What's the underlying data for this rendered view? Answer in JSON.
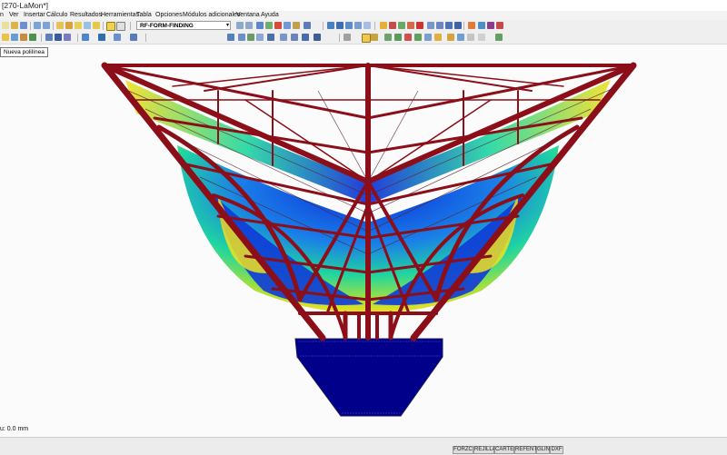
{
  "window": {
    "title": "[270-LaMon*]"
  },
  "menu": [
    "n",
    "Ver",
    "Insertar",
    "Cálculo",
    "Resultados",
    "Herramientas",
    "Tabla",
    "Opciones",
    "Módulos adicionales",
    "Ventana",
    "Ayuda"
  ],
  "toolbar": {
    "module_select": "RF-FORM-FINDING",
    "module_select_arrow": "▾"
  },
  "tooltip": {
    "text": "Nueva polilínea"
  },
  "status": {
    "coordinate": "u: 0.0 mm"
  },
  "status_buttons": [
    "FORZC",
    "REJILLA",
    "CARTES",
    "REFENT",
    "GLIN",
    "DXF"
  ],
  "colors": {
    "frame": "#8b0e18",
    "support_box": "#00008b",
    "membrane_low": "#0a28d8",
    "membrane_mid": "#1fd6a0",
    "membrane_high": "#f0e020"
  },
  "icons": [
    "new-file-icon",
    "open-icon",
    "save-icon",
    "print-icon",
    "undo-icon",
    "redo-icon",
    "zoom-icon",
    "render-icon",
    "view-icon",
    "results-icon",
    "settings-icon",
    "help-icon"
  ]
}
